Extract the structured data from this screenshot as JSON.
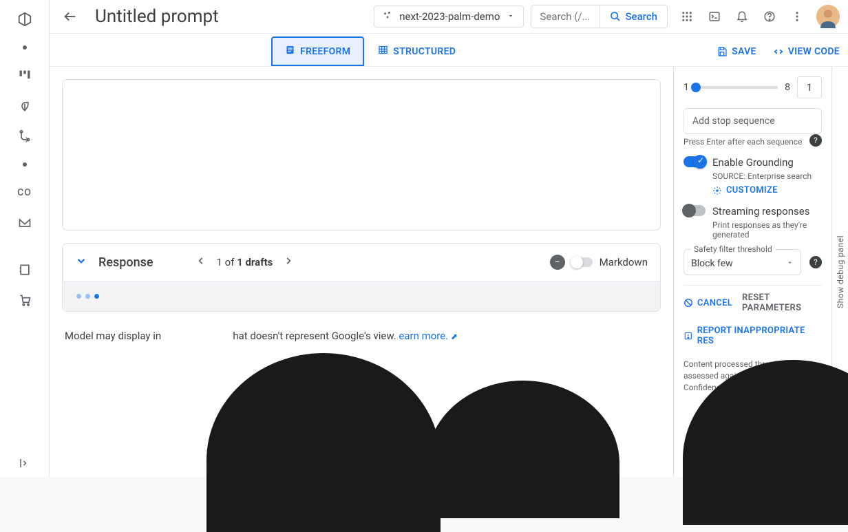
{
  "project": {
    "name": "next-2023-palm-demo"
  },
  "search": {
    "placeholder": "Search (/...",
    "button": "Search"
  },
  "page": {
    "title": "Untitled prompt"
  },
  "tabs": {
    "freeform": "FREEFORM",
    "structured": "STRUCTURED"
  },
  "actions": {
    "save": "SAVE",
    "view_code": "VIEW CODE"
  },
  "response": {
    "title": "Response",
    "drafts_text_prefix": "1 of ",
    "drafts_text_bold": "1 drafts",
    "markdown_label": "Markdown"
  },
  "disclaimer": {
    "text_a": "Model may display in",
    "text_b": "hat doesn't represent Google's view.",
    "learn_more": "earn more."
  },
  "panel": {
    "slider_min": "1",
    "slider_max": "8",
    "slider_value": "1",
    "stop_placeholder": "Add stop sequence",
    "stop_hint": "Press Enter after each sequence",
    "grounding_label": "Enable Grounding",
    "grounding_source_label": "SOURCE:",
    "grounding_source_value": "Enterprise search",
    "customize": "CUSTOMIZE",
    "streaming_label": "Streaming responses",
    "streaming_hint": "Print responses as they're generated",
    "safety_label": "Safety filter threshold",
    "safety_value": "Block few",
    "cancel": "CANCEL",
    "reset": "RESET PARAMETERS",
    "report": "REPORT INAPPROPRIATE RES",
    "policy": "Content processed through Vertex is assessed against a list of safety. Confidence scores for these a"
  },
  "debug": {
    "label": "Show debug panel"
  }
}
